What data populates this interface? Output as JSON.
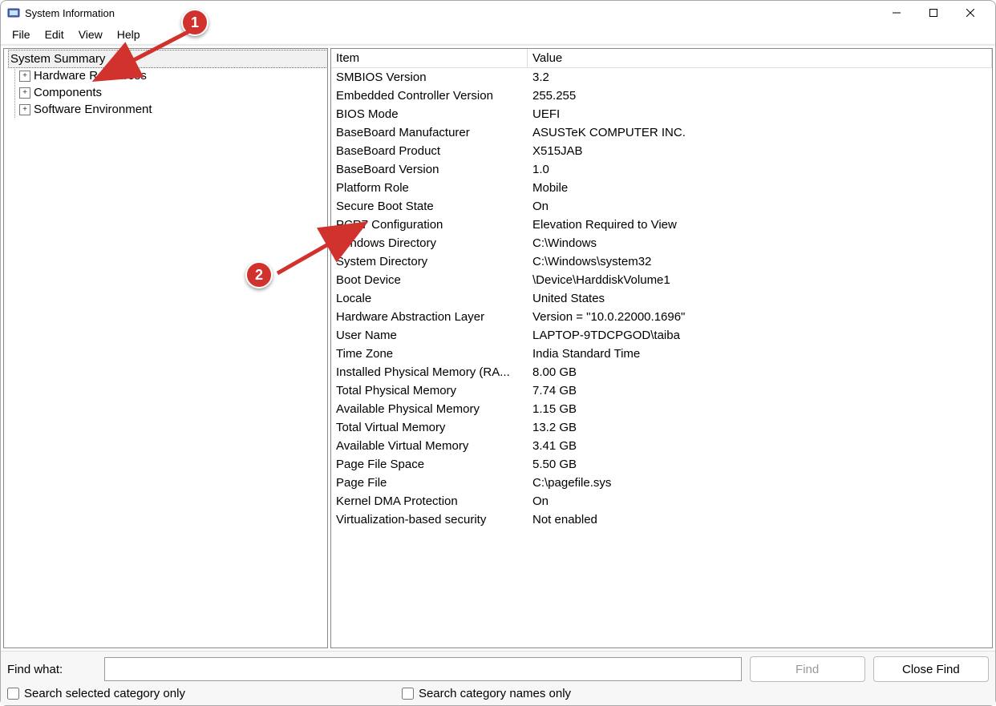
{
  "window": {
    "title": "System Information"
  },
  "menu": {
    "items": [
      "File",
      "Edit",
      "View",
      "Help"
    ]
  },
  "tree": {
    "root": "System Summary",
    "children": [
      "Hardware Resources",
      "Components",
      "Software Environment"
    ]
  },
  "table": {
    "headers": {
      "item": "Item",
      "value": "Value"
    },
    "rows": [
      {
        "item": "SMBIOS Version",
        "value": "3.2"
      },
      {
        "item": "Embedded Controller Version",
        "value": "255.255"
      },
      {
        "item": "BIOS Mode",
        "value": "UEFI"
      },
      {
        "item": "BaseBoard Manufacturer",
        "value": "ASUSTeK COMPUTER INC."
      },
      {
        "item": "BaseBoard Product",
        "value": "X515JAB"
      },
      {
        "item": "BaseBoard Version",
        "value": "1.0"
      },
      {
        "item": "Platform Role",
        "value": "Mobile"
      },
      {
        "item": "Secure Boot State",
        "value": "On"
      },
      {
        "item": "PCR7 Configuration",
        "value": "Elevation Required to View"
      },
      {
        "item": "Windows Directory",
        "value": "C:\\Windows"
      },
      {
        "item": "System Directory",
        "value": "C:\\Windows\\system32"
      },
      {
        "item": "Boot Device",
        "value": "\\Device\\HarddiskVolume1"
      },
      {
        "item": "Locale",
        "value": "United States"
      },
      {
        "item": "Hardware Abstraction Layer",
        "value": "Version = \"10.0.22000.1696\""
      },
      {
        "item": "User Name",
        "value": "LAPTOP-9TDCPGOD\\taiba"
      },
      {
        "item": "Time Zone",
        "value": "India Standard Time"
      },
      {
        "item": "Installed Physical Memory (RA...",
        "value": "8.00 GB"
      },
      {
        "item": "Total Physical Memory",
        "value": "7.74 GB"
      },
      {
        "item": "Available Physical Memory",
        "value": "1.15 GB"
      },
      {
        "item": "Total Virtual Memory",
        "value": "13.2 GB"
      },
      {
        "item": "Available Virtual Memory",
        "value": "3.41 GB"
      },
      {
        "item": "Page File Space",
        "value": "5.50 GB"
      },
      {
        "item": "Page File",
        "value": "C:\\pagefile.sys"
      },
      {
        "item": "Kernel DMA Protection",
        "value": "On"
      },
      {
        "item": "Virtualization-based security",
        "value": "Not enabled"
      }
    ]
  },
  "search": {
    "label": "Find what:",
    "value": "",
    "find_button": "Find",
    "close_button": "Close Find",
    "checkbox1": "Search selected category only",
    "checkbox2": "Search category names only"
  },
  "annotations": {
    "one": "1",
    "two": "2"
  }
}
